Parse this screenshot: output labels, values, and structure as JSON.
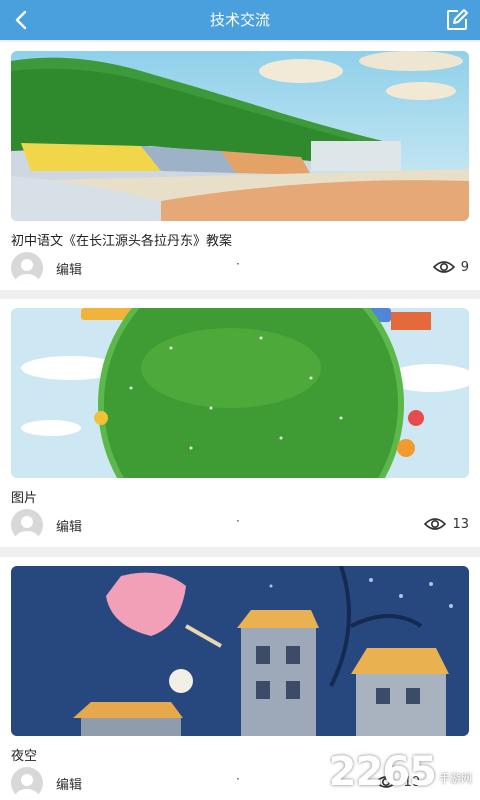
{
  "header": {
    "title": "技术交流",
    "back_icon": "chevron-left-icon",
    "edit_icon": "edit-icon"
  },
  "posts": [
    {
      "caption": "初中语文《在长江源头各拉丹东》教案",
      "author": "编辑",
      "separator": "·",
      "views": "9"
    },
    {
      "caption": "图片",
      "author": "编辑",
      "separator": "·",
      "views": "13"
    },
    {
      "caption": "夜空",
      "author": "编辑",
      "separator": "·",
      "views": "10"
    }
  ],
  "watermark": {
    "number": "2265",
    "text": "手游网"
  },
  "colors": {
    "header": "#4aa0dc",
    "background": "#efefef"
  }
}
